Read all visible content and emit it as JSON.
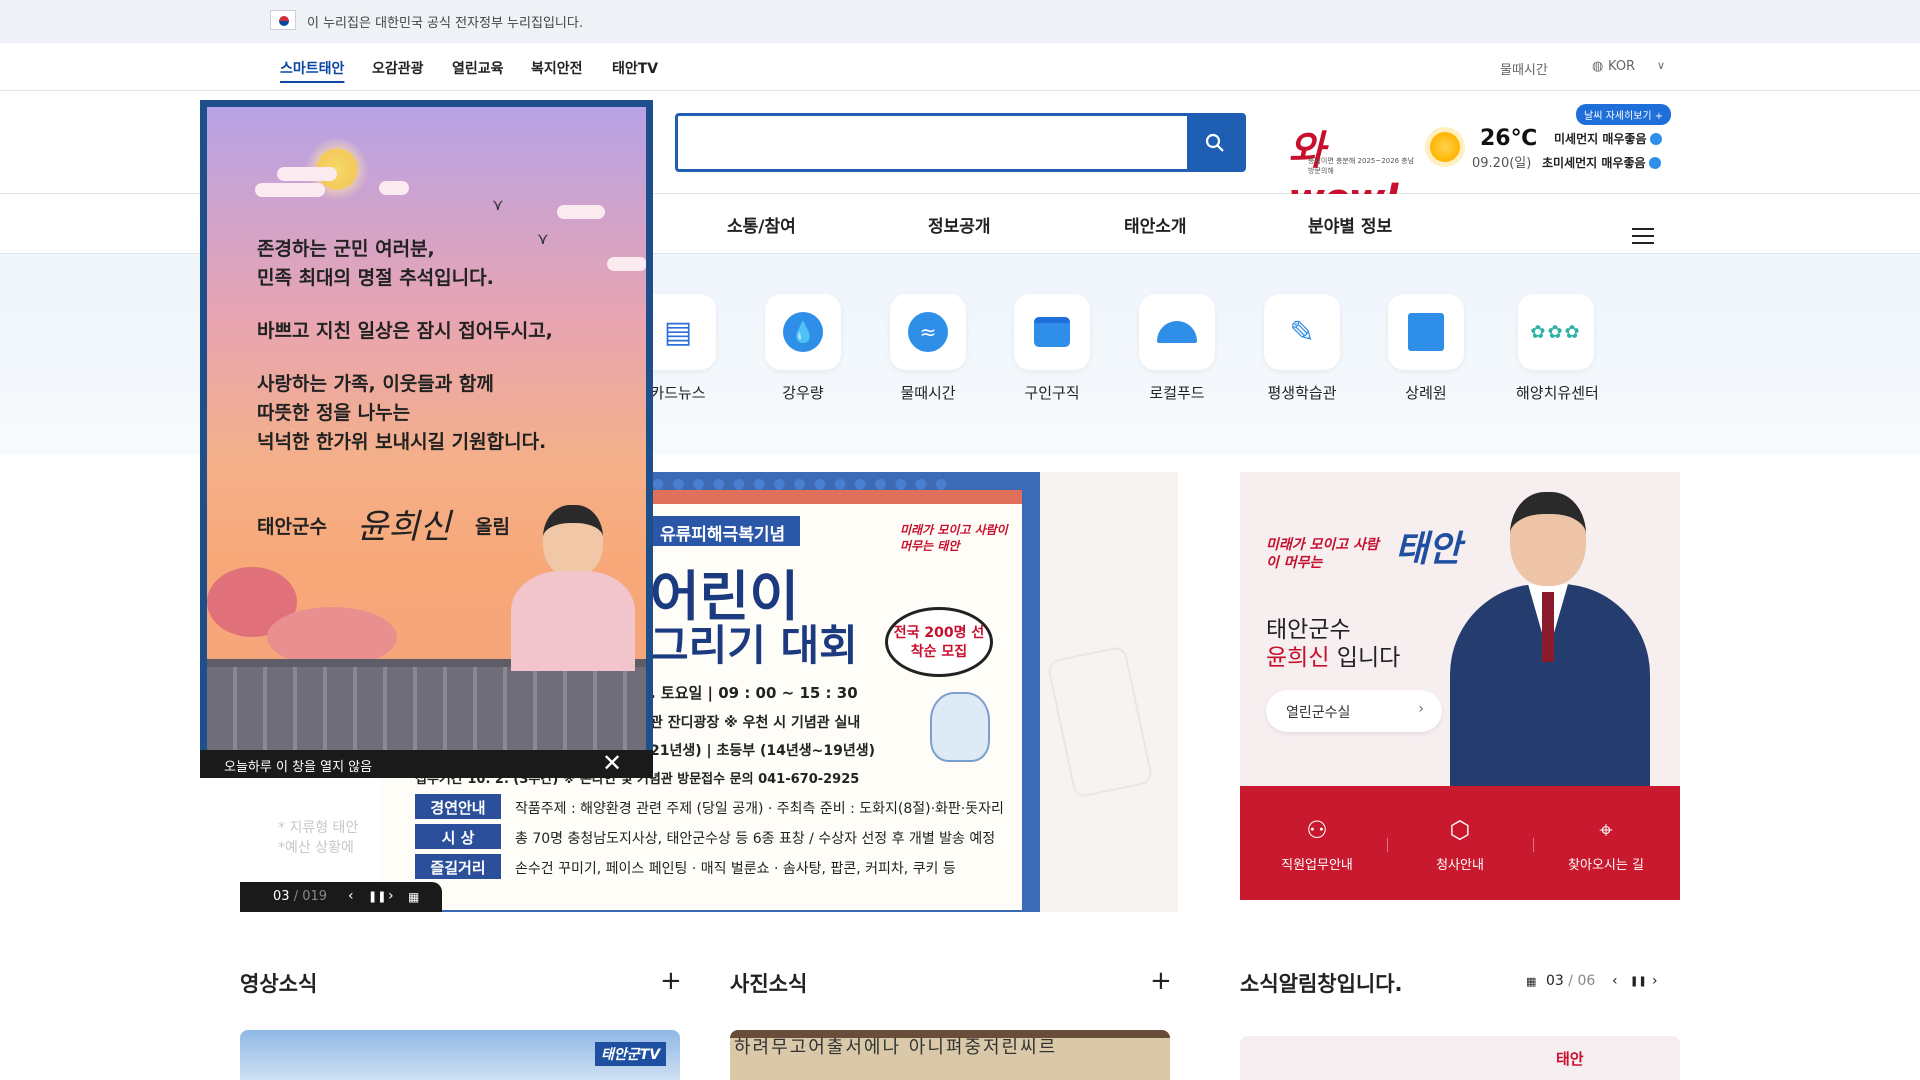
{
  "gov_banner": {
    "text": "이 누리집은 대한민국 공식 전자정부 누리집입니다."
  },
  "top_nav": {
    "items": [
      "스마트태안",
      "오감관광",
      "열린교육",
      "복지안전",
      "태안TV"
    ],
    "active_index": 0,
    "util": {
      "tide": "물때시간",
      "lang": "KOR"
    }
  },
  "header": {
    "search": {
      "value": "",
      "placeholder": ""
    },
    "campaign": {
      "main": "와wow!",
      "sub": "충남이면 충분해 2025~2026 충남방문의해"
    },
    "weather": {
      "button": "날씨 자세히보기 +",
      "temp": "26℃",
      "date": "09.20(일)",
      "fine_dust": "미세먼지 매우좋음",
      "ultrafine_dust": "초미세먼지 매우좋음"
    }
  },
  "gnb": {
    "items": [
      "소통/참여",
      "정보공개",
      "태안소개",
      "분야별 정보"
    ]
  },
  "quick_menu": [
    "카드뉴스",
    "강우량",
    "물때시간",
    "구인구직",
    "로컬푸드",
    "평생학습관",
    "상례원",
    "해양치유센터"
  ],
  "main_banner": {
    "label": "유류피해극복기념관",
    "title_line1": "어린이",
    "title_line2": "그리기 대회",
    "bubble": "전국 200명 선착순 모집",
    "brand": "미래가 모이고 사람이 머무는 태안",
    "line_date": ". 토요일 | 09 : 00 ~ 15 : 30",
    "line_place": "관 잔디광장 ※ 우천 시 기념관 실내",
    "line_age": "21년생) | 초등부 (14년생~19년생)",
    "line_apply": "접수기간 10. 2. (3주간) ※ 온라인 및 기념관 방문접수 문의 041-670-2925",
    "rows": [
      {
        "tag": "경연안내",
        "text": "작품주제 : 해양환경 관련 주제 (당일 공개) · 주최측 준비 : 도화지(8절)·화판·돗자리"
      },
      {
        "tag": "시 상",
        "text": "총 70명 충청남도지사상, 태안군수상 등 6종 표창 / 수상자 선정 후 개별 발송 예정"
      },
      {
        "tag": "즐길거리",
        "text": "손수건 꾸미기, 페이스 페인팅 · 매직 벌룬쇼 · 솜사탕, 팝콘, 커피차, 쿠키 등"
      }
    ],
    "faded_text": [
      "* 지류형 태안",
      "*예산 상황에"
    ],
    "counter_current": "03",
    "counter_total": "019"
  },
  "popup": {
    "lines": [
      "존경하는 군민 여러분,",
      "민족 최대의 명절 추석입니다.",
      "바쁘고 지친 일상은 잠시 접어두시고,",
      "사랑하는 가족, 이웃들과 함께",
      "따뜻한 정을 나누는",
      "넉넉한 한가위 보내시길 기원합니다."
    ],
    "signature_title": "태안군수",
    "signature": "윤희신",
    "signature_end": "올림",
    "dismiss_label": "오늘하루 이 창을 열지 않음"
  },
  "mayor_card": {
    "brand_small": "미래가 모이고 사람이 머무는",
    "brand_big": "태안",
    "title": "태안군수",
    "name": "윤희신",
    "name_suffix": " 입니다",
    "button": "열린군수실",
    "links": [
      "직원업무안내",
      "청사안내",
      "찾아오시는 길"
    ]
  },
  "sections": {
    "video": {
      "title": "영상소식",
      "badge": "태안군TV"
    },
    "photo": {
      "title": "사진소식",
      "board_text": "하려무고어출서에나 아니펴중저린씨르"
    },
    "notice": {
      "title": "소식알림창입니다.",
      "current": "03",
      "total": "06",
      "logo": "태안"
    }
  },
  "colors": {
    "primary": "#1e5fb4",
    "accent_red": "#c8192e",
    "text": "#222222"
  }
}
